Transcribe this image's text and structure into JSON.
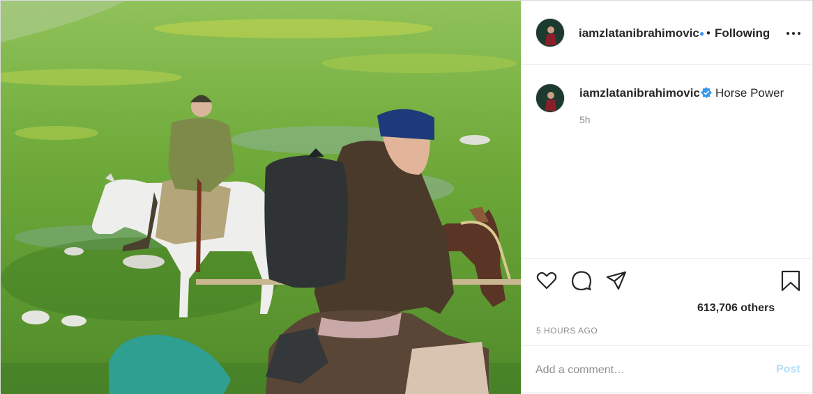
{
  "post": {
    "image": {
      "description_icon": "photo-horse-riders"
    },
    "header": {
      "username": "iamzlatanibrahimovic",
      "separator": "•",
      "follow_status": "Following",
      "verified_icon": "verified-badge-icon",
      "more_icon": "more-options-icon"
    },
    "caption": {
      "username": "iamzlatanibrahimovic",
      "text": "Horse Power",
      "time": "5h"
    },
    "actions": {
      "like_icon": "heart-icon",
      "comment_icon": "comment-icon",
      "share_icon": "share-icon",
      "save_icon": "bookmark-icon"
    },
    "likes": "613,706 others",
    "timestamp": "5 HOURS AGO",
    "comment": {
      "placeholder": "Add a comment…",
      "post_label": "Post"
    },
    "colors": {
      "verified": "#3897f0",
      "post_button_disabled": "#b2dffc",
      "secondary_text": "#8e8e8e"
    }
  }
}
